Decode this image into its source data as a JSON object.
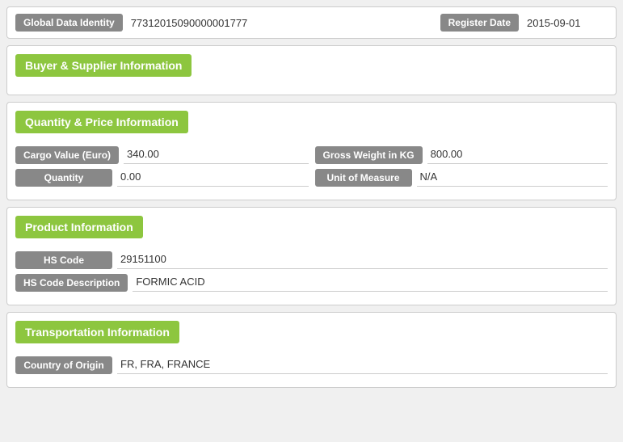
{
  "topBar": {
    "globalDataIdentityLabel": "Global Data Identity",
    "globalDataIdentityValue": "77312015090000001777",
    "registerDateLabel": "Register Date",
    "registerDateValue": "2015-09-01"
  },
  "sections": {
    "buyerSupplier": {
      "header": "Buyer & Supplier Information",
      "fields": []
    },
    "quantityPrice": {
      "header": "Quantity & Price Information",
      "rows": [
        {
          "left": {
            "label": "Cargo Value (Euro)",
            "value": "340.00"
          },
          "right": {
            "label": "Gross Weight in KG",
            "value": "800.00"
          }
        },
        {
          "left": {
            "label": "Quantity",
            "value": "0.00"
          },
          "right": {
            "label": "Unit of Measure",
            "value": "N/A"
          }
        }
      ]
    },
    "productInfo": {
      "header": "Product Information",
      "rows": [
        {
          "label": "HS Code",
          "value": "29151100"
        },
        {
          "label": "HS Code Description",
          "value": "FORMIC ACID"
        }
      ]
    },
    "transportationInfo": {
      "header": "Transportation Information",
      "rows": [
        {
          "label": "Country of Origin",
          "value": "FR, FRA, FRANCE"
        }
      ]
    }
  }
}
